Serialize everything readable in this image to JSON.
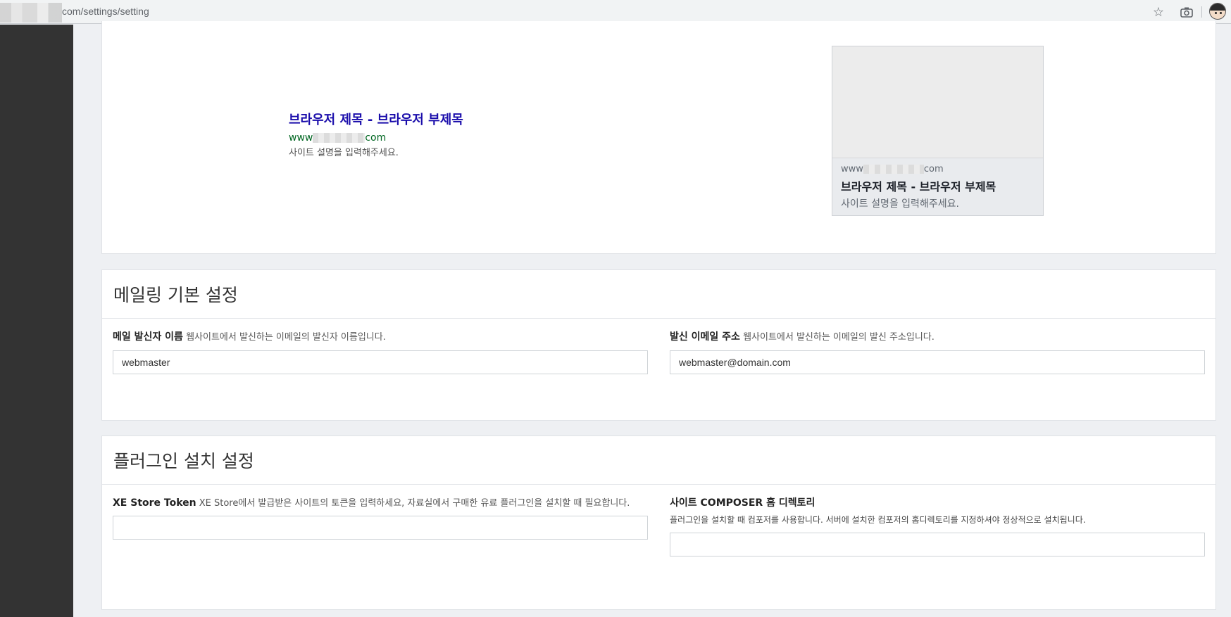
{
  "browser": {
    "url": "com/settings/setting"
  },
  "preview": {
    "search": {
      "title": "브라우저 제목 - 브라우저 부제목",
      "url_prefix": "www",
      "url_suffix": "com",
      "description": "사이트 설명을 입력해주세요."
    },
    "facebook": {
      "url_prefix": "www",
      "url_suffix": "com",
      "title": "브라우저 제목 - 브라우저 부제목",
      "description": "사이트 설명을 입력해주세요."
    }
  },
  "mailing": {
    "title": "메일링 기본 설정",
    "sender_name": {
      "label": "메일 발신자 이름",
      "help": "웹사이트에서 발신하는 이메일의 발신자 이름입니다.",
      "value": "webmaster"
    },
    "sender_email": {
      "label": "발신 이메일 주소",
      "help": "웹사이트에서 발신하는 이메일의 발신 주소입니다.",
      "value": "webmaster@domain.com"
    }
  },
  "plugin": {
    "title": "플러그인 설치 설정",
    "store_token": {
      "label": "XE Store Token",
      "help": "XE Store에서 발급받은 사이트의 토큰을 입력하세요, 자료실에서 구매한 유료 플러그인을 설치할 때 필요합니다.",
      "value": ""
    },
    "composer_home": {
      "label": "사이트 COMPOSER 홈 디렉토리",
      "help": "플러그인을 설치할 때 컴포저를 사용합니다. 서버에 설치한 컴포저의 홈디렉토리를 지정하셔야 정상적으로 설치됩니다.",
      "value": ""
    }
  },
  "icons": {
    "bookmark": "star-icon",
    "screenshot": "camera-icon",
    "profile": "avatar"
  }
}
